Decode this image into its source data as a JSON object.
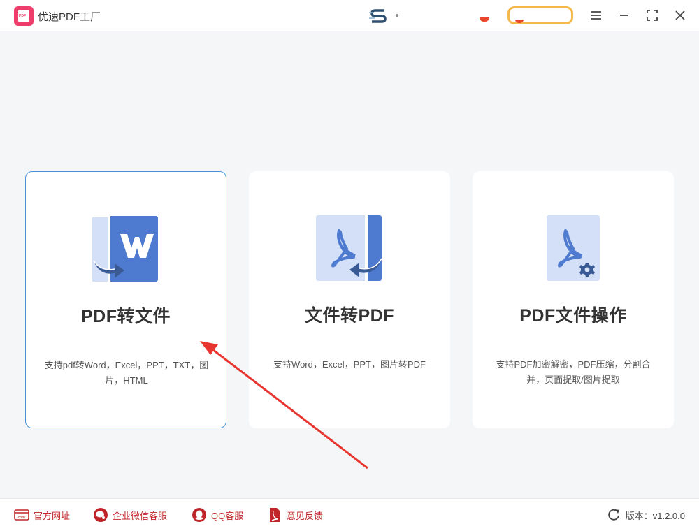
{
  "app": {
    "title": "优速PDF工厂"
  },
  "cards": [
    {
      "title": "PDF转文件",
      "desc": "支持pdf转Word，Excel，PPT，TXT，图片，HTML",
      "icon": "pdf-to-word-icon"
    },
    {
      "title": "文件转PDF",
      "desc": "支持Word，Excel，PPT，图片转PDF",
      "icon": "file-to-pdf-icon"
    },
    {
      "title": "PDF文件操作",
      "desc": "支持PDF加密解密，PDF压缩，分割合并，页面提取/图片提取",
      "icon": "pdf-settings-icon"
    }
  ],
  "footer": {
    "website": "官方网址",
    "wechat": "企业微信客服",
    "qq": "QQ客服",
    "feedback": "意见反馈",
    "version": "版本：v1.2.0.0"
  },
  "colors": {
    "accent": "#4a90d9",
    "brand": "#ee3d6a",
    "footer_link": "#c0252a",
    "icon_blue": "#4e7bd0",
    "icon_light": "#d3e0f7"
  }
}
